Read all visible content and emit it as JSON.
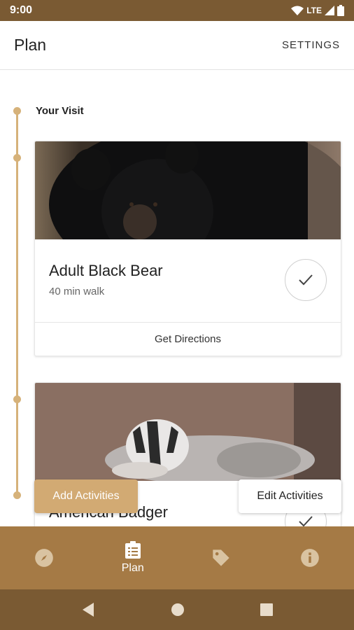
{
  "status_bar": {
    "time": "9:00",
    "network": "LTE"
  },
  "app_bar": {
    "title": "Plan",
    "settings_label": "SETTINGS"
  },
  "timeline": {
    "section_title": "Your Visit"
  },
  "cards": [
    {
      "title": "Adult Black Bear",
      "subtitle": "40 min walk",
      "action_label": "Get Directions",
      "image": "black-bear-photo"
    },
    {
      "title": "American Badger",
      "image": "badger-photo"
    }
  ],
  "actions": {
    "add_label": "Add Activities",
    "edit_label": "Edit Activities"
  },
  "bottom_nav": {
    "items": [
      {
        "icon": "compass-icon",
        "label": ""
      },
      {
        "icon": "list-icon",
        "label": "Plan"
      },
      {
        "icon": "tag-icon",
        "label": ""
      },
      {
        "icon": "info-icon",
        "label": ""
      }
    ],
    "active": "Plan"
  },
  "colors": {
    "status_bar": "#7a5a33",
    "bottom_nav": "#a57a45",
    "accent": "#d2aa73",
    "timeline": "#d6b27a"
  }
}
